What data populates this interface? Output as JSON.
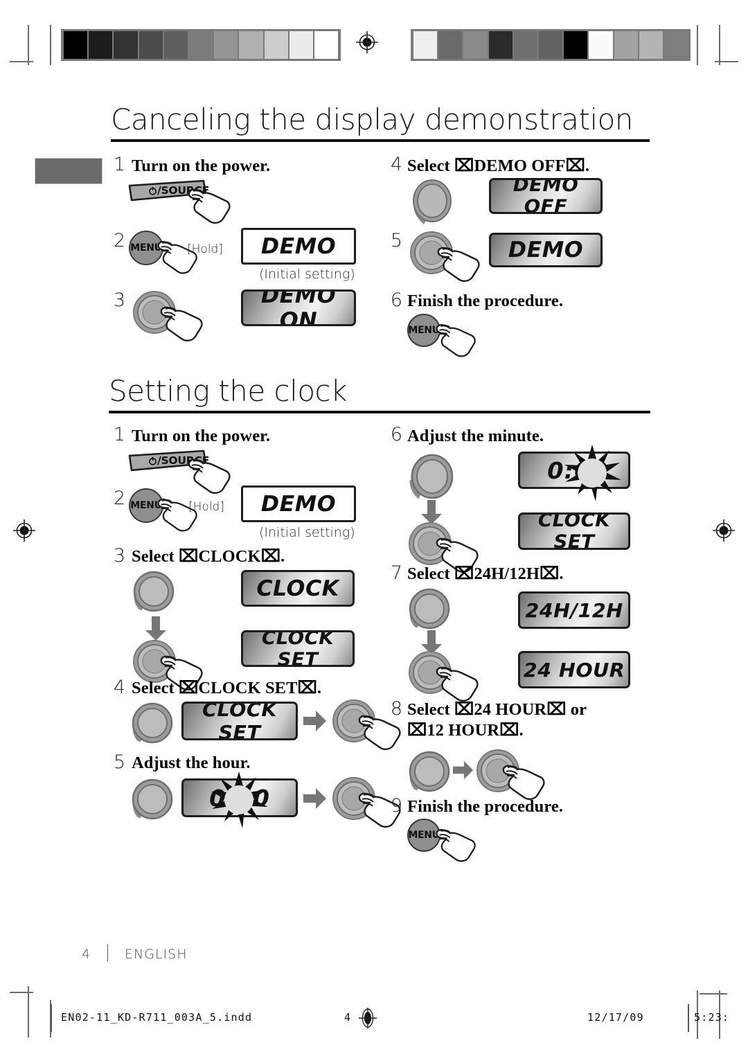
{
  "document": {
    "footer_page_number": "4",
    "footer_language": "ENGLISH",
    "print_filename": "EN02-11_KD-R711_003A_5.indd",
    "print_page": "4",
    "print_date": "12/17/09",
    "print_time": "5:23:"
  },
  "calibration": {
    "left_wedge": [
      "#000000",
      "#1c1c1c",
      "#333333",
      "#4b4b4b",
      "#5f5f5f",
      "#7b7b7b",
      "#959595",
      "#b0b0b0",
      "#cdcdcd",
      "#ebebeb",
      "#ffffff"
    ],
    "right_wedge": [
      "#efefef",
      "#6a6a6a",
      "#8a8a8a",
      "#2b2b2b",
      "#6f6f6f",
      "#636363",
      "#000000",
      "#fbfbfb",
      "#a3a3a3",
      "#b4b4b4",
      "#7e7e7e"
    ]
  },
  "sections": [
    {
      "id": "canceling-demo",
      "title": "Canceling the display demonstration",
      "steps": [
        {
          "num": "1",
          "text": "Turn on the power."
        },
        {
          "num": "2",
          "text": "",
          "hold": "[Hold]"
        },
        {
          "num": "3",
          "text": ""
        },
        {
          "num": "4",
          "text": "Select ⌧DEMO OFF⌧."
        },
        {
          "num": "5",
          "text": ""
        },
        {
          "num": "6",
          "text": "Finish the procedure."
        }
      ],
      "displays": [
        {
          "id": "demo-initial",
          "text": "DEMO",
          "style": "plain",
          "caption": "(Initial setting)"
        },
        {
          "id": "demo-on",
          "text": "DEMO ON",
          "style": "fill"
        },
        {
          "id": "demo-off",
          "text": "DEMO OFF",
          "style": "fill"
        },
        {
          "id": "demo-again",
          "text": "DEMO",
          "style": "fill"
        }
      ],
      "buttons": {
        "source": "/SOURCE",
        "menu": "MENU"
      }
    },
    {
      "id": "setting-clock",
      "title": "Setting the clock",
      "steps": [
        {
          "num": "1",
          "text": "Turn on the power."
        },
        {
          "num": "2",
          "text": "",
          "hold": "[Hold]"
        },
        {
          "num": "3",
          "text": "Select ⌧CLOCK⌧."
        },
        {
          "num": "4",
          "text": "Select ⌧CLOCK SET⌧."
        },
        {
          "num": "5",
          "text": "Adjust the hour."
        },
        {
          "num": "6",
          "text": "Adjust the minute."
        },
        {
          "num": "7",
          "text": "Select ⌧24H/12H⌧."
        },
        {
          "num": "8",
          "text": "Select ⌧24 HOUR⌧ or\n⌧12 HOUR⌧."
        },
        {
          "num": "9",
          "text": "Finish the procedure."
        }
      ],
      "displays": [
        {
          "id": "clk-demo-initial",
          "text": "DEMO",
          "style": "plain",
          "caption": "(Initial setting)"
        },
        {
          "id": "clk-clock",
          "text": "CLOCK",
          "style": "fill"
        },
        {
          "id": "clk-clockset-1",
          "text": "CLOCK SET",
          "style": "fill"
        },
        {
          "id": "clk-clockset-2",
          "text": "CLOCK SET",
          "style": "fill"
        },
        {
          "id": "clk-hour",
          "text": "0:00",
          "style": "fill",
          "blink": true
        },
        {
          "id": "clk-minute",
          "text": "0:00",
          "style": "fill",
          "blink": true
        },
        {
          "id": "clk-clockset-3",
          "text": "CLOCK SET",
          "style": "fill"
        },
        {
          "id": "clk-2412",
          "text": "24H/12H",
          "style": "fill"
        },
        {
          "id": "clk-24hour",
          "text": "24 HOUR",
          "style": "fill"
        }
      ],
      "buttons": {
        "source": "/SOURCE",
        "menu": "MENU"
      }
    }
  ],
  "icons": {
    "power": "power-icon",
    "hand": "pointing-hand-icon",
    "knob": "rotary-knob-icon",
    "arrow_right": "arrow-right-icon",
    "arrow_down": "arrow-down-icon",
    "registration": "registration-mark-icon"
  }
}
